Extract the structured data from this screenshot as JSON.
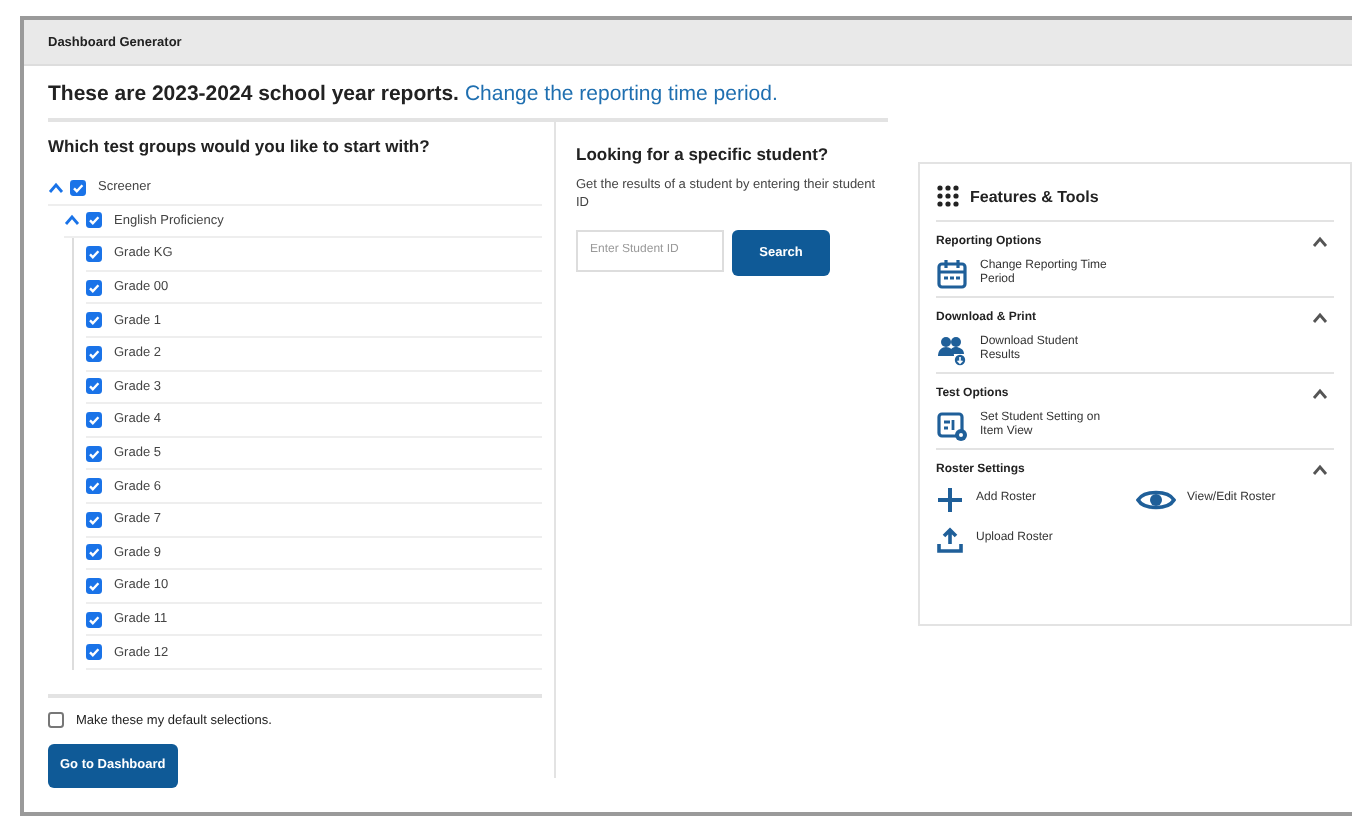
{
  "window": {
    "title": "Dashboard Generator"
  },
  "header": {
    "text": "These are 2023-2024 school year reports.",
    "link": "Change the reporting time period."
  },
  "test_groups": {
    "heading": "Which test groups would you like to start with?",
    "tree": [
      {
        "label": "Screener",
        "checked": true,
        "expanded": true,
        "children": [
          {
            "label": "English Proficiency",
            "checked": true,
            "expanded": true,
            "children": [
              {
                "label": "Grade KG",
                "checked": true
              },
              {
                "label": "Grade 00",
                "checked": true
              },
              {
                "label": "Grade 1",
                "checked": true
              },
              {
                "label": "Grade 2",
                "checked": true
              },
              {
                "label": "Grade 3",
                "checked": true
              },
              {
                "label": "Grade 4",
                "checked": true
              },
              {
                "label": "Grade 5",
                "checked": true
              },
              {
                "label": "Grade 6",
                "checked": true
              },
              {
                "label": "Grade 7",
                "checked": true
              },
              {
                "label": "Grade 9",
                "checked": true
              },
              {
                "label": "Grade 10",
                "checked": true
              },
              {
                "label": "Grade 11",
                "checked": true
              },
              {
                "label": "Grade 12",
                "checked": true
              }
            ]
          }
        ]
      }
    ],
    "default_option": {
      "label": "Make these my default selections.",
      "checked": false
    },
    "button": "Go to Dashboard"
  },
  "student_search": {
    "heading": "Looking for a specific student?",
    "description": "Get the results of a student by entering their student ID",
    "placeholder": "Enter Student ID",
    "button": "Search"
  },
  "features": {
    "title": "Features & Tools",
    "sections": [
      {
        "title": "Reporting Options",
        "expanded": true,
        "items": [
          {
            "label": "Change Reporting Time Period",
            "kind": "calendar"
          }
        ]
      },
      {
        "title": "Download & Print",
        "expanded": true,
        "items": [
          {
            "label": "Download Student Results",
            "kind": "download-people"
          }
        ]
      },
      {
        "title": "Test Options",
        "expanded": true,
        "items": [
          {
            "label": "Set Student Setting on Item View",
            "kind": "settings-sheet"
          }
        ]
      },
      {
        "title": "Roster Settings",
        "expanded": true,
        "items": [
          {
            "label": "Add Roster",
            "kind": "plus"
          },
          {
            "label": "View/Edit Roster",
            "kind": "eye"
          },
          {
            "label": "Upload Roster",
            "kind": "upload"
          }
        ]
      }
    ]
  }
}
